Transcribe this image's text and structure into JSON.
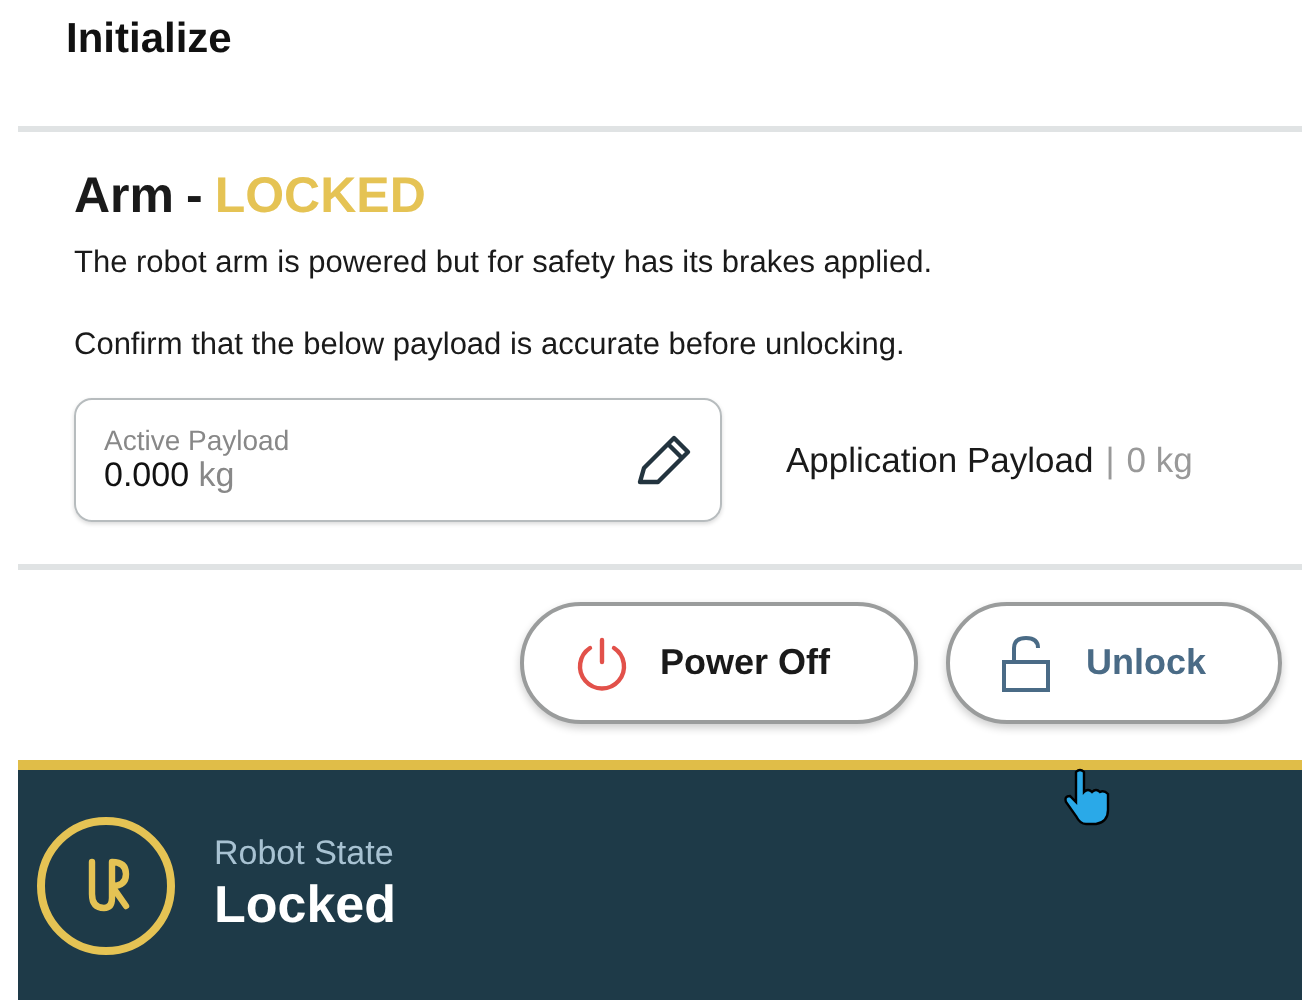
{
  "header": {
    "title": "Initialize"
  },
  "arm": {
    "title": "Arm",
    "title_separator": "-",
    "status": "LOCKED",
    "messages": [
      "The robot arm is powered but for safety has its brakes applied.",
      "Confirm that the below payload is accurate before unlocking."
    ],
    "payload_field": {
      "label": "Active Payload",
      "value": "0.000",
      "unit": "kg"
    },
    "application_payload": {
      "label": "Application Payload",
      "separator": "|",
      "value": "0 kg"
    }
  },
  "buttons": [
    {
      "label": "Power Off",
      "kind": "power"
    },
    {
      "label": "Unlock",
      "kind": "unlock"
    }
  ],
  "status_bar": {
    "label": "Robot State",
    "state": "Locked"
  }
}
